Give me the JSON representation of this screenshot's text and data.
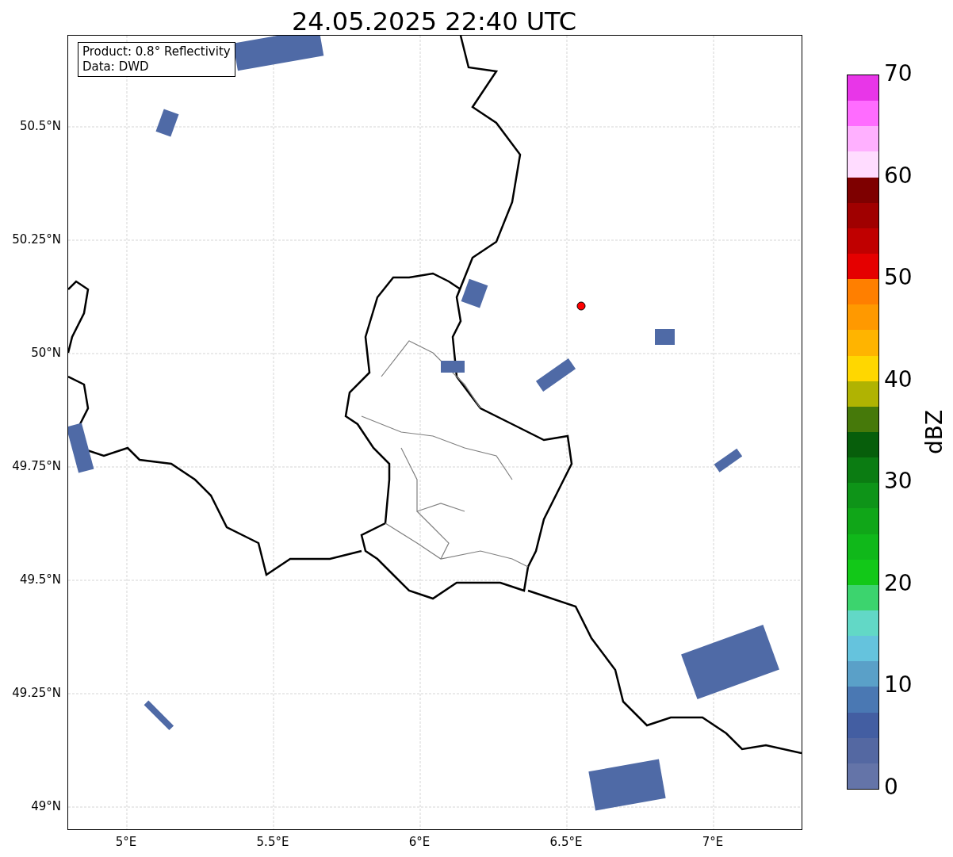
{
  "title": "24.05.2025 22:40 UTC",
  "info_box": {
    "lines": [
      "Product: 0.8° Reflectivity",
      "Data: DWD"
    ]
  },
  "y_ticks": [
    "50.5°N",
    "50.25°N",
    "50°N",
    "49.75°N",
    "49.5°N",
    "49.25°N",
    "49°N"
  ],
  "x_ticks": [
    "5°E",
    "5.5°E",
    "6°E",
    "6.5°E",
    "7°E"
  ],
  "colorbar": {
    "label": "dBZ",
    "ticks": [
      "70",
      "60",
      "50",
      "40",
      "30",
      "20",
      "10",
      "0"
    ],
    "bands": [
      {
        "color": "#e836e8"
      },
      {
        "color": "#ff6cff"
      },
      {
        "color": "#ffb0ff"
      },
      {
        "color": "#ffdcff"
      },
      {
        "color": "#7e0000"
      },
      {
        "color": "#a00000"
      },
      {
        "color": "#c00000"
      },
      {
        "color": "#e50000"
      },
      {
        "color": "#ff7f00"
      },
      {
        "color": "#ff9900"
      },
      {
        "color": "#ffb400"
      },
      {
        "color": "#ffd700"
      },
      {
        "color": "#b0b302"
      },
      {
        "color": "#46790a"
      },
      {
        "color": "#075e0b"
      },
      {
        "color": "#0b7c12"
      },
      {
        "color": "#0e9418"
      },
      {
        "color": "#10a618"
      },
      {
        "color": "#10b81a"
      },
      {
        "color": "#12c818"
      },
      {
        "color": "#3cd46e"
      },
      {
        "color": "#62d8c6"
      },
      {
        "color": "#65c3dd"
      },
      {
        "color": "#5aa0c8"
      },
      {
        "color": "#4a78b3"
      },
      {
        "color": "#435ea2"
      },
      {
        "color": "#5468a2"
      },
      {
        "color": "#6474a8"
      }
    ]
  }
}
